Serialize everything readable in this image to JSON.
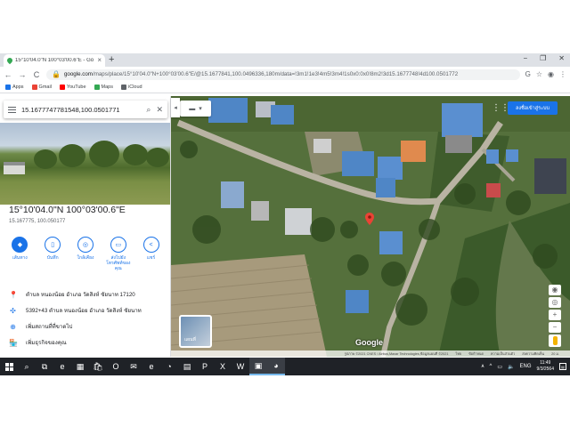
{
  "browser": {
    "tab_title": "15°10'04.0\"N 100°03'00.6\"E - Go",
    "tab_close": "×",
    "new_tab": "+",
    "win_minimize": "−",
    "win_restore": "❐",
    "win_close": "✕",
    "back": "←",
    "forward": "→",
    "reload": "C",
    "url_host": "google.com",
    "url_path": "/maps/place/15°10'04.0\"N+100°03'00.6\"E/@15.1677841,100.0496336,180m/data=!3m1!1e3!4m5!3m4!1s0x0:0x0!8m2!3d15.1677748!4d100.0501772",
    "bookmarks": [
      {
        "label": "Apps",
        "color": "#1a73e8"
      },
      {
        "label": "Gmail",
        "color": "#ea4335"
      },
      {
        "label": "YouTube",
        "color": "#ff0000"
      },
      {
        "label": "Maps",
        "color": "#34a853"
      },
      {
        "label": "iCloud",
        "color": "#5f6368"
      }
    ]
  },
  "panel": {
    "search_value": "15.1677747781548,100.0501771",
    "place_title": "15°10'04.0\"N 100°03'00.6\"E",
    "place_sub": "15.167775, 100.050177",
    "actions": [
      {
        "label": "เส้นทาง",
        "icon": "◆"
      },
      {
        "label": "บันทึก",
        "icon": "▯"
      },
      {
        "label": "ใกล้เคียง",
        "icon": "◎"
      },
      {
        "label": "ส่งไปยังโทรศัพท์ของคุณ",
        "icon": "▭"
      },
      {
        "label": "แชร์",
        "icon": "<"
      }
    ],
    "address": "ตำบล หนองน้อย อำเภอ วัดสิงห์ ชัยนาท 17120",
    "plus_code": "5392+43 ตำบล หนองน้อย อำเภอ วัดสิงห์ ชัยนาท",
    "add_missing": "เพิ่มสถานที่ที่ขาดไป",
    "add_business": "เพิ่มธุรกิจของคุณ",
    "collapse": "◂"
  },
  "map": {
    "layer_button": "▾",
    "apps_grid": "⋮⋮⋮",
    "signin": "ลงชื่อเข้าสู่ระบบ",
    "thumb_label": "แผนที่",
    "logo": "Google",
    "zoom_in": "+",
    "zoom_out": "−",
    "compass": "◉",
    "footer": [
      "รูปภาพ ©2021 CNES / Airbus,Maxar Technologies,ข้อมูลแผนที่ ©2021",
      "ไทย",
      "ข้อกำหนด",
      "ความเป็นส่วนตัว",
      "ส่งความคิดเห็น",
      "20 ม."
    ],
    "pin_color": "#ea4335"
  },
  "taskbar": {
    "apps": [
      "⌕",
      "⧉",
      "e",
      "▦",
      "🛍",
      "O",
      "✉",
      "e",
      "◔",
      "▤",
      "P",
      "X",
      "W",
      "▣",
      "◕"
    ],
    "tray_icons": [
      "ᴀ",
      "^",
      "▭",
      "🔈",
      "ENG"
    ],
    "time": "11:49",
    "date": "9/3/2564",
    "notif": "▤"
  }
}
